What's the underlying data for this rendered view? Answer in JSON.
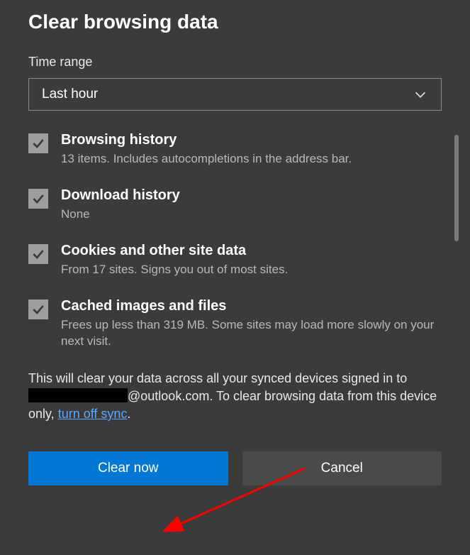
{
  "dialog": {
    "title": "Clear browsing data",
    "timeRangeLabel": "Time range",
    "timeRangeValue": "Last hour"
  },
  "options": [
    {
      "title": "Browsing history",
      "desc": "13 items. Includes autocompletions in the address bar."
    },
    {
      "title": "Download history",
      "desc": "None"
    },
    {
      "title": "Cookies and other site data",
      "desc": "From 17 sites. Signs you out of most sites."
    },
    {
      "title": "Cached images and files",
      "desc": "Frees up less than 319 MB. Some sites may load more slowly on your next visit."
    }
  ],
  "syncNotice": {
    "pre": "This will clear your data across all your synced devices signed in to ",
    "emailSuffix": "@outlook.com",
    "post1": ". To clear browsing data from this device only, ",
    "link": "turn off sync",
    "post2": "."
  },
  "buttons": {
    "primary": "Clear now",
    "secondary": "Cancel"
  }
}
